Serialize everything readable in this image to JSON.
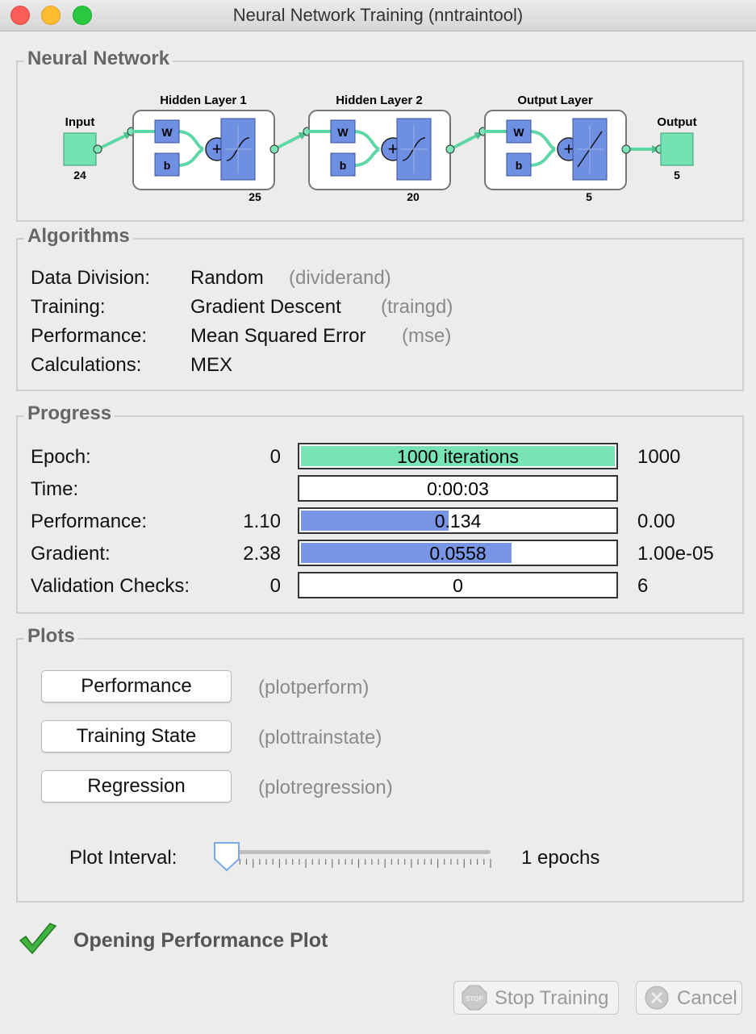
{
  "window": {
    "title": "Neural Network Training (nntraintool)"
  },
  "network": {
    "section_title": "Neural Network",
    "input": {
      "label": "Input",
      "size": "24"
    },
    "layers": [
      {
        "title": "Hidden Layer 1",
        "size": "25",
        "weight_label": "W",
        "bias_label": "b"
      },
      {
        "title": "Hidden Layer 2",
        "size": "20",
        "weight_label": "W",
        "bias_label": "b"
      },
      {
        "title": "Output Layer",
        "size": "5",
        "weight_label": "W",
        "bias_label": "b"
      }
    ],
    "output": {
      "label": "Output",
      "size": "5"
    },
    "colors": {
      "node": "#74e3b4",
      "block": "#6f8fe3",
      "line": "#5fd6a6"
    }
  },
  "algorithms": {
    "section_title": "Algorithms",
    "rows": [
      {
        "label": "Data Division:",
        "value": "Random",
        "fn": "(dividerand)"
      },
      {
        "label": "Training:",
        "value": "Gradient Descent",
        "fn": "(traingd)"
      },
      {
        "label": "Performance:",
        "value": "Mean Squared Error",
        "fn": "(mse)"
      },
      {
        "label": "Calculations:",
        "value": "MEX",
        "fn": ""
      }
    ]
  },
  "progress": {
    "section_title": "Progress",
    "rows": [
      {
        "label": "Epoch:",
        "min": "0",
        "value": "1000 iterations",
        "max": "1000",
        "fill": 1.0,
        "color": "#78e3b5"
      },
      {
        "label": "Time:",
        "min": "",
        "value": "0:00:03",
        "max": "",
        "fill": 0,
        "color": "#ffffff"
      },
      {
        "label": "Performance:",
        "min": "1.10",
        "value": "0.134",
        "max": "0.00",
        "fill": 0.47,
        "color": "#7895e6"
      },
      {
        "label": "Gradient:",
        "min": "2.38",
        "value": "0.0558",
        "max": "1.00e-05",
        "fill": 0.67,
        "color": "#7895e6"
      },
      {
        "label": "Validation Checks:",
        "min": "0",
        "value": "0",
        "max": "6",
        "fill": 0,
        "color": "#7895e6"
      }
    ]
  },
  "plots": {
    "section_title": "Plots",
    "buttons": [
      {
        "label": "Performance",
        "fn": "(plotperform)"
      },
      {
        "label": "Training State",
        "fn": "(plottrainstate)"
      },
      {
        "label": "Regression",
        "fn": "(plotregression)"
      }
    ],
    "interval_label": "Plot Interval:",
    "interval_value": "1 epochs",
    "slider_position": 0
  },
  "status": {
    "text": "Opening Performance Plot"
  },
  "footer": {
    "stop_label": "Stop Training",
    "stop_icon_text": "STOP",
    "cancel_label": "Cancel"
  }
}
